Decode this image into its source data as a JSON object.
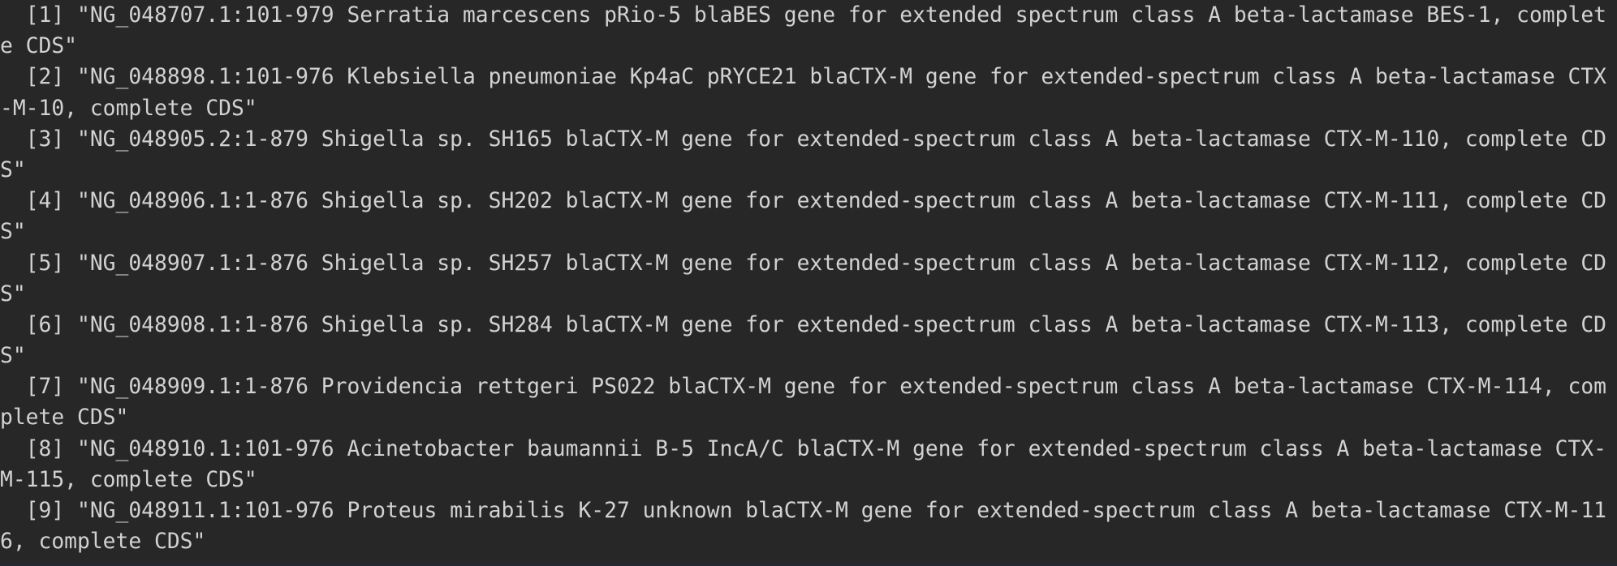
{
  "console": {
    "lines": [
      "  [1] \"NG_048707.1:101-979 Serratia marcescens pRio-5 blaBES gene for extended spectrum class A beta-lactamase BES-1, complet",
      "e CDS\"",
      "  [2] \"NG_048898.1:101-976 Klebsiella pneumoniae Kp4aC pRYCE21 blaCTX-M gene for extended-spectrum class A beta-lactamase CTX",
      "-M-10, complete CDS\"",
      "  [3] \"NG_048905.2:1-879 Shigella sp. SH165 blaCTX-M gene for extended-spectrum class A beta-lactamase CTX-M-110, complete CD",
      "S\"",
      "  [4] \"NG_048906.1:1-876 Shigella sp. SH202 blaCTX-M gene for extended-spectrum class A beta-lactamase CTX-M-111, complete CD",
      "S\"",
      "  [5] \"NG_048907.1:1-876 Shigella sp. SH257 blaCTX-M gene for extended-spectrum class A beta-lactamase CTX-M-112, complete CD",
      "S\"",
      "  [6] \"NG_048908.1:1-876 Shigella sp. SH284 blaCTX-M gene for extended-spectrum class A beta-lactamase CTX-M-113, complete CD",
      "S\"",
      "  [7] \"NG_048909.1:1-876 Providencia rettgeri PS022 blaCTX-M gene for extended-spectrum class A beta-lactamase CTX-M-114, com",
      "plete CDS\"",
      "  [8] \"NG_048910.1:101-976 Acinetobacter baumannii B-5 IncA/C blaCTX-M gene for extended-spectrum class A beta-lactamase CTX-",
      "M-115, complete CDS\"",
      "  [9] \"NG_048911.1:101-976 Proteus mirabilis K-27 unknown blaCTX-M gene for extended-spectrum class A beta-lactamase CTX-M-11",
      "6, complete CDS\""
    ]
  },
  "colors": {
    "background": "#272727",
    "text": "#d2d2d2"
  }
}
